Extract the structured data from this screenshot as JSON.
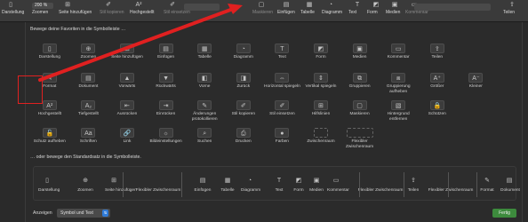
{
  "toolbar": {
    "zoom_value": "200 %",
    "items": [
      {
        "label": "Darstellung",
        "dim": false
      },
      {
        "label": "Zoomen",
        "dim": false
      },
      {
        "label": "Seite hinzufügen",
        "dim": false
      },
      {
        "label": "Stil kopieren",
        "dim": true
      },
      {
        "label": "Hochgestellt",
        "dim": false
      },
      {
        "label": "Stil einsetzen",
        "dim": true
      },
      {
        "label": "Maskieren",
        "dim": true
      },
      {
        "label": "Einfügen",
        "dim": false
      },
      {
        "label": "Tabelle",
        "dim": false
      },
      {
        "label": "Diagramm",
        "dim": false
      },
      {
        "label": "Text",
        "dim": false
      },
      {
        "label": "Form",
        "dim": false
      },
      {
        "label": "Medien",
        "dim": false
      },
      {
        "label": "Kommentar",
        "dim": true
      },
      {
        "label": "Teilen",
        "dim": false
      }
    ]
  },
  "sheet": {
    "favorites_title": "Bewege deine Favoriten in die Symbolleiste …",
    "default_title": "… oder bewege den Standardsatz in die Symbolleiste.",
    "rows": [
      [
        {
          "label": "Darstellung",
          "icon": "sidebar-icon",
          "glyph": "▯"
        },
        {
          "label": "Zoomen",
          "icon": "zoom-icon",
          "glyph": "⊕"
        },
        {
          "label": "Seite hinzufügen",
          "icon": "add-page-icon",
          "glyph": "⊞"
        },
        {
          "label": "Einfügen",
          "icon": "insert-icon",
          "glyph": "▤"
        },
        {
          "label": "Tabelle",
          "icon": "table-icon",
          "glyph": "▦"
        },
        {
          "label": "Diagramm",
          "icon": "chart-icon",
          "glyph": "◔"
        },
        {
          "label": "Text",
          "icon": "text-icon",
          "glyph": "T"
        },
        {
          "label": "Form",
          "icon": "shape-icon",
          "glyph": "◩"
        },
        {
          "label": "Medien",
          "icon": "media-icon",
          "glyph": "▣"
        },
        {
          "label": "Kommentar",
          "icon": "comment-icon",
          "glyph": "▭"
        },
        {
          "label": "Teilen",
          "icon": "share-icon",
          "glyph": "⇪"
        }
      ],
      [
        {
          "label": "Format",
          "icon": "format-icon",
          "glyph": "✎"
        },
        {
          "label": "Dokument",
          "icon": "document-icon",
          "glyph": "▤"
        },
        {
          "label": "Vorwärts",
          "icon": "forward-icon",
          "glyph": "▲"
        },
        {
          "label": "Rückwärts",
          "icon": "backward-icon",
          "glyph": "▼"
        },
        {
          "label": "Vorne",
          "icon": "front-icon",
          "glyph": "◧"
        },
        {
          "label": "Zurück",
          "icon": "back-icon",
          "glyph": "◨"
        },
        {
          "label": "Horizontal spiegeln",
          "icon": "flip-horizontal-icon",
          "glyph": "⇔"
        },
        {
          "label": "Vertikal spiegeln",
          "icon": "flip-vertical-icon",
          "glyph": "⇕"
        },
        {
          "label": "Gruppieren",
          "icon": "group-icon",
          "glyph": "⧉"
        },
        {
          "label": "Gruppierung aufheben",
          "icon": "ungroup-icon",
          "glyph": "⧈"
        },
        {
          "label": "Größer",
          "icon": "bigger-icon",
          "glyph": "A⁺"
        },
        {
          "label": "Kleiner",
          "icon": "smaller-icon",
          "glyph": "A⁻"
        }
      ],
      [
        {
          "label": "Hochgestellt",
          "icon": "superscript-icon",
          "glyph": "A²"
        },
        {
          "label": "Tiefgestellt",
          "icon": "subscript-icon",
          "glyph": "A₂"
        },
        {
          "label": "Ausrücken",
          "icon": "outdent-icon",
          "glyph": "⇤"
        },
        {
          "label": "Einrücken",
          "icon": "indent-icon",
          "glyph": "⇥"
        },
        {
          "label": "Änderungen protokollieren",
          "icon": "track-changes-icon",
          "glyph": "✎"
        },
        {
          "label": "Stil kopieren",
          "icon": "copy-style-icon",
          "glyph": "✐"
        },
        {
          "label": "Stil einsetzen",
          "icon": "paste-style-icon",
          "glyph": "✐"
        },
        {
          "label": "Hilfslinien",
          "icon": "guides-icon",
          "glyph": "⊞"
        },
        {
          "label": "Maskieren",
          "icon": "mask-icon",
          "glyph": "▢"
        },
        {
          "label": "Hintergrund entfernen",
          "icon": "remove-background-icon",
          "glyph": "▧"
        },
        {
          "label": "Schützen",
          "icon": "lock-icon",
          "glyph": "🔒"
        }
      ],
      [
        {
          "label": "Schutz aufheben",
          "icon": "unlock-icon",
          "glyph": "🔓"
        },
        {
          "label": "Schriften",
          "icon": "fonts-icon",
          "glyph": "Aa"
        },
        {
          "label": "Link",
          "icon": "link-icon",
          "glyph": "🔗"
        },
        {
          "label": "Bildeinstellungen",
          "icon": "image-settings-icon",
          "glyph": "☼"
        },
        {
          "label": "Suchen",
          "icon": "search-icon",
          "glyph": "⌕"
        },
        {
          "label": "Drucken",
          "icon": "print-icon",
          "glyph": "⎙"
        },
        {
          "label": "Farben",
          "icon": "colors-icon",
          "glyph": "●"
        },
        {
          "label": "Zwischenraum",
          "icon": "space-icon",
          "glyph": ""
        },
        {
          "label": "Flexibler Zwischenraum",
          "icon": "flexible-space-icon",
          "glyph": ""
        }
      ]
    ],
    "default_set": [
      {
        "label": "Darstellung",
        "glyph": "▯",
        "icon": "sidebar-icon"
      },
      {
        "label": "Zoomen",
        "glyph": "⊕",
        "icon": "zoom-icon"
      },
      {
        "label": "Seite hinzufügen",
        "glyph": "⊞",
        "icon": "add-page-icon"
      },
      {
        "label": "Flexibler Zwischenraum",
        "glyph": "",
        "icon": "flexible-space-icon"
      },
      {
        "label": "Einfügen",
        "glyph": "▤",
        "icon": "insert-icon"
      },
      {
        "label": "Tabelle",
        "glyph": "▦",
        "icon": "table-icon"
      },
      {
        "label": "Diagramm",
        "glyph": "◔",
        "icon": "chart-icon"
      },
      {
        "label": "Text",
        "glyph": "T",
        "icon": "text-icon"
      },
      {
        "label": "Form",
        "glyph": "◩",
        "icon": "shape-icon"
      },
      {
        "label": "Medien",
        "glyph": "▣",
        "icon": "media-icon"
      },
      {
        "label": "Kommentar",
        "glyph": "▭",
        "icon": "comment-icon"
      },
      {
        "label": "Flexibler Zwischenraum",
        "glyph": "",
        "icon": "flexible-space-icon"
      },
      {
        "label": "Teilen",
        "glyph": "⇪",
        "icon": "share-icon"
      },
      {
        "label": "Flexibler Zwischenraum",
        "glyph": "",
        "icon": "flexible-space-icon"
      },
      {
        "label": "Format",
        "glyph": "✎",
        "icon": "format-icon"
      },
      {
        "label": "Dokument",
        "glyph": "▤",
        "icon": "document-icon"
      }
    ],
    "show_label": "Anzeigen",
    "show_value": "Symbol und Text",
    "done_label": "Fertig",
    "highlight_color": "#e02020",
    "done_color": "#3d8b3d"
  }
}
